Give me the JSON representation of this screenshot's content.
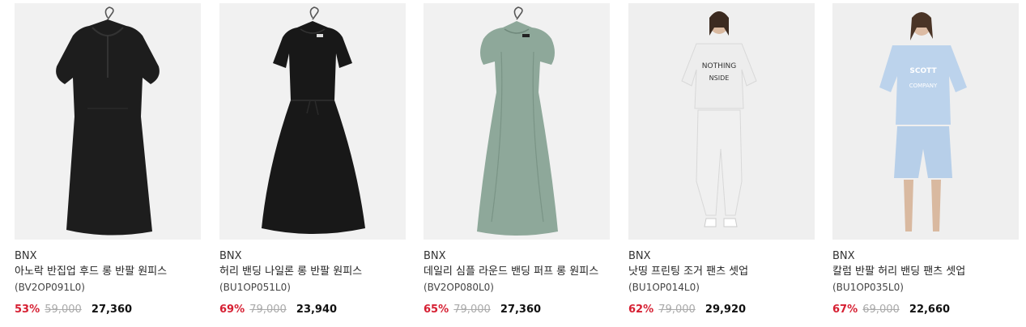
{
  "products": [
    {
      "brand": "BNX",
      "name": "아노락 반집업 후드 롱 반팔 원피스",
      "code": "(BV2OP091L0)",
      "discount": "53%",
      "original_price": "59,000",
      "sale_price": "27,360",
      "color": "#1a1a1a",
      "image": "black-hooded-dress"
    },
    {
      "brand": "BNX",
      "name": "허리 밴딩 나일론 롱 반팔 원피스",
      "code": "(BU1OP051L0)",
      "discount": "69%",
      "original_price": "79,000",
      "sale_price": "23,940",
      "color": "#161616",
      "image": "black-waist-dress"
    },
    {
      "brand": "BNX",
      "name": "데일리 심플 라운드 밴딩 퍼프 롱 원피스",
      "code": "(BV2OP080L0)",
      "discount": "65%",
      "original_price": "79,000",
      "sale_price": "27,360",
      "color": "#8ea89a",
      "image": "mint-puff-dress"
    },
    {
      "brand": "BNX",
      "name": "낫띵 프린팅 조거 팬츠 셋업",
      "code": "(BU1OP014L0)",
      "discount": "62%",
      "original_price": "79,000",
      "sale_price": "29,920",
      "color": "#ededed",
      "image": "white-jogger-setup"
    },
    {
      "brand": "BNX",
      "name": "칼럼 반팔 허리 밴딩 팬츠 셋업",
      "code": "(BU1OP035L0)",
      "discount": "67%",
      "original_price": "69,000",
      "sale_price": "22,660",
      "color": "#bcd3ec",
      "image": "blue-shorts-setup"
    }
  ],
  "colors": {
    "discount": "#d61f32",
    "original_price": "#aaaaaa"
  }
}
